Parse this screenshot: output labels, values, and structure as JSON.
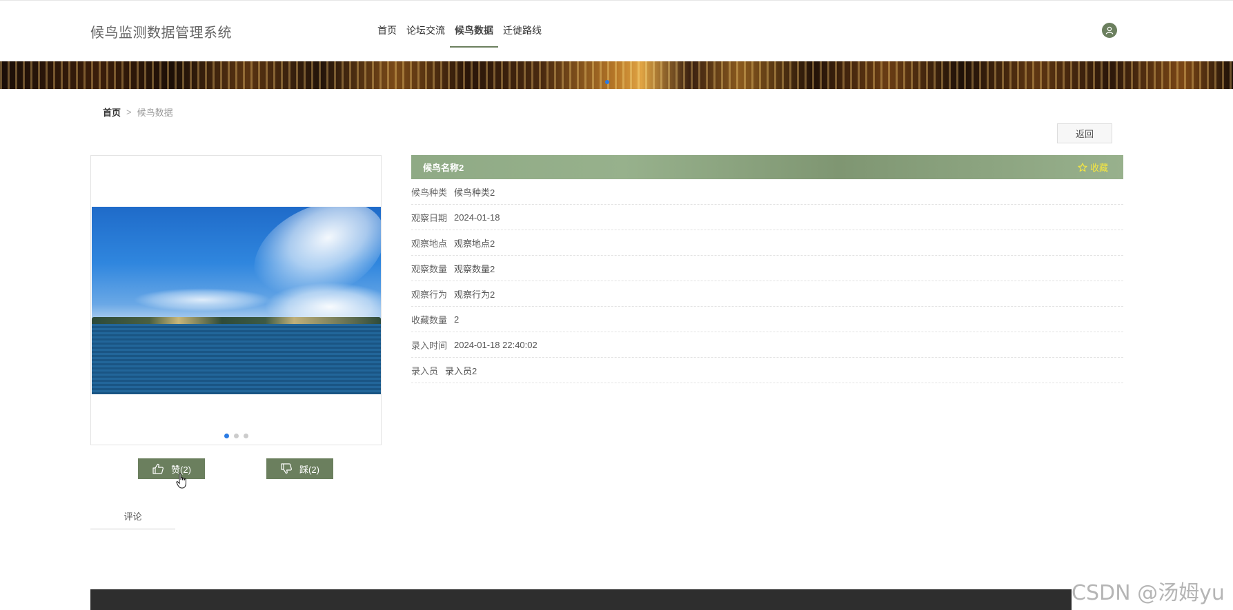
{
  "header": {
    "site_title": "候鸟监测数据管理系统",
    "nav": [
      "首页",
      "论坛交流",
      "候鸟数据",
      "迁徙路线"
    ],
    "active_nav": "候鸟数据"
  },
  "breadcrumb": {
    "home": "首页",
    "separator": ">",
    "current": "候鸟数据"
  },
  "back_label": "返回",
  "detail": {
    "title": "候鸟名称2",
    "favorite_label": "收藏",
    "fields": [
      {
        "label": "候鸟种类",
        "value": "候鸟种类2"
      },
      {
        "label": "观察日期",
        "value": "2024-01-18"
      },
      {
        "label": "观察地点",
        "value": "观察地点2"
      },
      {
        "label": "观察数量",
        "value": "观察数量2"
      },
      {
        "label": "观察行为",
        "value": "观察行为2"
      },
      {
        "label": "收藏数量",
        "value": "2"
      },
      {
        "label": "录入时间",
        "value": "2024-01-18 22:40:02"
      },
      {
        "label": "录入员",
        "value": "录入员2"
      }
    ]
  },
  "carousel": {
    "slides": 3,
    "active": 1
  },
  "votes": {
    "like_label": "赞(2)",
    "dislike_label": "踩(2)"
  },
  "tabs": {
    "comment_label": "评论"
  },
  "watermark": "CSDN @汤姆yu",
  "colors": {
    "accent": "#6b7f5e",
    "header_bar": "#8faa85",
    "favorite": "#f5e640",
    "carousel_active": "#2a7be4",
    "footer": "#2e2e2e"
  }
}
